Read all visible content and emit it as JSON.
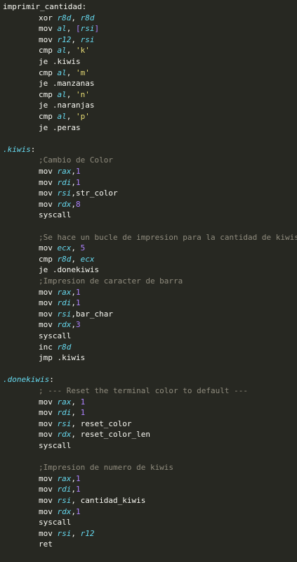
{
  "colors": {
    "background": "#272822",
    "foreground": "#f8f8f2",
    "register": "#66d9ef",
    "number": "#ae81ff",
    "string": "#e6db74",
    "label": "#66d9ef",
    "comment": "#908c7e"
  },
  "code_lines": [
    {
      "indent": 0,
      "tokens": [
        {
          "t": "imprimir_cantidad:",
          "c": "plain"
        }
      ]
    },
    {
      "indent": 1,
      "tokens": [
        {
          "t": "xor ",
          "c": "plain"
        },
        {
          "t": "r8d",
          "c": "reg"
        },
        {
          "t": ", ",
          "c": "plain"
        },
        {
          "t": "r8d",
          "c": "reg"
        }
      ]
    },
    {
      "indent": 1,
      "tokens": [
        {
          "t": "mov ",
          "c": "plain"
        },
        {
          "t": "al",
          "c": "reg"
        },
        {
          "t": ", ",
          "c": "plain"
        },
        {
          "t": "[",
          "c": "num"
        },
        {
          "t": "rsi",
          "c": "reg"
        },
        {
          "t": "]",
          "c": "num"
        }
      ]
    },
    {
      "indent": 1,
      "tokens": [
        {
          "t": "mov ",
          "c": "plain"
        },
        {
          "t": "r12",
          "c": "reg"
        },
        {
          "t": ", ",
          "c": "plain"
        },
        {
          "t": "rsi",
          "c": "reg"
        }
      ]
    },
    {
      "indent": 1,
      "tokens": [
        {
          "t": "cmp ",
          "c": "plain"
        },
        {
          "t": "al",
          "c": "reg"
        },
        {
          "t": ", ",
          "c": "plain"
        },
        {
          "t": "'k'",
          "c": "str"
        }
      ]
    },
    {
      "indent": 1,
      "tokens": [
        {
          "t": "je .kiwis",
          "c": "plain"
        }
      ]
    },
    {
      "indent": 1,
      "tokens": [
        {
          "t": "cmp ",
          "c": "plain"
        },
        {
          "t": "al",
          "c": "reg"
        },
        {
          "t": ", ",
          "c": "plain"
        },
        {
          "t": "'m'",
          "c": "str"
        }
      ]
    },
    {
      "indent": 1,
      "tokens": [
        {
          "t": "je .manzanas",
          "c": "plain"
        }
      ]
    },
    {
      "indent": 1,
      "tokens": [
        {
          "t": "cmp ",
          "c": "plain"
        },
        {
          "t": "al",
          "c": "reg"
        },
        {
          "t": ", ",
          "c": "plain"
        },
        {
          "t": "'n'",
          "c": "str"
        }
      ]
    },
    {
      "indent": 1,
      "tokens": [
        {
          "t": "je .naranjas",
          "c": "plain"
        }
      ]
    },
    {
      "indent": 1,
      "tokens": [
        {
          "t": "cmp ",
          "c": "plain"
        },
        {
          "t": "al",
          "c": "reg"
        },
        {
          "t": ", ",
          "c": "plain"
        },
        {
          "t": "'p'",
          "c": "str"
        }
      ]
    },
    {
      "indent": 1,
      "tokens": [
        {
          "t": "je .peras",
          "c": "plain"
        }
      ]
    },
    {
      "indent": 0,
      "tokens": []
    },
    {
      "indent": 0,
      "tokens": [
        {
          "t": ".kiwis",
          "c": "lbl"
        },
        {
          "t": ":",
          "c": "plain"
        }
      ]
    },
    {
      "indent": 1,
      "tokens": [
        {
          "t": ";Cambio de Color",
          "c": "cmt"
        }
      ]
    },
    {
      "indent": 1,
      "tokens": [
        {
          "t": "mov ",
          "c": "plain"
        },
        {
          "t": "rax",
          "c": "reg"
        },
        {
          "t": ",",
          "c": "plain"
        },
        {
          "t": "1",
          "c": "num"
        }
      ]
    },
    {
      "indent": 1,
      "tokens": [
        {
          "t": "mov ",
          "c": "plain"
        },
        {
          "t": "rdi",
          "c": "reg"
        },
        {
          "t": ",",
          "c": "plain"
        },
        {
          "t": "1",
          "c": "num"
        }
      ]
    },
    {
      "indent": 1,
      "tokens": [
        {
          "t": "mov ",
          "c": "plain"
        },
        {
          "t": "rsi",
          "c": "reg"
        },
        {
          "t": ",str_color",
          "c": "plain"
        }
      ]
    },
    {
      "indent": 1,
      "tokens": [
        {
          "t": "mov ",
          "c": "plain"
        },
        {
          "t": "rdx",
          "c": "reg"
        },
        {
          "t": ",",
          "c": "plain"
        },
        {
          "t": "8",
          "c": "num"
        }
      ]
    },
    {
      "indent": 1,
      "tokens": [
        {
          "t": "syscall",
          "c": "plain"
        }
      ]
    },
    {
      "indent": 0,
      "tokens": []
    },
    {
      "indent": 1,
      "tokens": [
        {
          "t": ";Se hace un bucle de impresion para la cantidad de kiwis",
          "c": "cmt"
        }
      ]
    },
    {
      "indent": 1,
      "tokens": [
        {
          "t": "mov ",
          "c": "plain"
        },
        {
          "t": "ecx",
          "c": "reg"
        },
        {
          "t": ", ",
          "c": "plain"
        },
        {
          "t": "5",
          "c": "num"
        }
      ]
    },
    {
      "indent": 1,
      "tokens": [
        {
          "t": "cmp ",
          "c": "plain"
        },
        {
          "t": "r8d",
          "c": "reg"
        },
        {
          "t": ", ",
          "c": "plain"
        },
        {
          "t": "ecx",
          "c": "reg"
        }
      ]
    },
    {
      "indent": 1,
      "tokens": [
        {
          "t": "je .donekiwis",
          "c": "plain"
        }
      ]
    },
    {
      "indent": 1,
      "tokens": [
        {
          "t": ";Impresion de caracter de barra",
          "c": "cmt"
        }
      ]
    },
    {
      "indent": 1,
      "tokens": [
        {
          "t": "mov ",
          "c": "plain"
        },
        {
          "t": "rax",
          "c": "reg"
        },
        {
          "t": ",",
          "c": "plain"
        },
        {
          "t": "1",
          "c": "num"
        }
      ]
    },
    {
      "indent": 1,
      "tokens": [
        {
          "t": "mov ",
          "c": "plain"
        },
        {
          "t": "rdi",
          "c": "reg"
        },
        {
          "t": ",",
          "c": "plain"
        },
        {
          "t": "1",
          "c": "num"
        }
      ]
    },
    {
      "indent": 1,
      "tokens": [
        {
          "t": "mov ",
          "c": "plain"
        },
        {
          "t": "rsi",
          "c": "reg"
        },
        {
          "t": ",bar_char",
          "c": "plain"
        }
      ]
    },
    {
      "indent": 1,
      "tokens": [
        {
          "t": "mov ",
          "c": "plain"
        },
        {
          "t": "rdx",
          "c": "reg"
        },
        {
          "t": ",",
          "c": "plain"
        },
        {
          "t": "3",
          "c": "num"
        }
      ]
    },
    {
      "indent": 1,
      "tokens": [
        {
          "t": "syscall",
          "c": "plain"
        }
      ]
    },
    {
      "indent": 1,
      "tokens": [
        {
          "t": "inc ",
          "c": "plain"
        },
        {
          "t": "r8d",
          "c": "reg"
        }
      ]
    },
    {
      "indent": 1,
      "tokens": [
        {
          "t": "jmp .kiwis",
          "c": "plain"
        }
      ]
    },
    {
      "indent": 0,
      "tokens": []
    },
    {
      "indent": 0,
      "tokens": [
        {
          "t": ".donekiwis",
          "c": "lbl"
        },
        {
          "t": ":",
          "c": "plain"
        }
      ]
    },
    {
      "indent": 1,
      "tokens": [
        {
          "t": "; --- Reset the terminal color to default ---",
          "c": "cmt"
        }
      ]
    },
    {
      "indent": 1,
      "tokens": [
        {
          "t": "mov ",
          "c": "plain"
        },
        {
          "t": "rax",
          "c": "reg"
        },
        {
          "t": ", ",
          "c": "plain"
        },
        {
          "t": "1",
          "c": "num"
        }
      ]
    },
    {
      "indent": 1,
      "tokens": [
        {
          "t": "mov ",
          "c": "plain"
        },
        {
          "t": "rdi",
          "c": "reg"
        },
        {
          "t": ", ",
          "c": "plain"
        },
        {
          "t": "1",
          "c": "num"
        }
      ]
    },
    {
      "indent": 1,
      "tokens": [
        {
          "t": "mov ",
          "c": "plain"
        },
        {
          "t": "rsi",
          "c": "reg"
        },
        {
          "t": ", reset_color",
          "c": "plain"
        }
      ]
    },
    {
      "indent": 1,
      "tokens": [
        {
          "t": "mov ",
          "c": "plain"
        },
        {
          "t": "rdx",
          "c": "reg"
        },
        {
          "t": ", reset_color_len",
          "c": "plain"
        }
      ]
    },
    {
      "indent": 1,
      "tokens": [
        {
          "t": "syscall",
          "c": "plain"
        }
      ]
    },
    {
      "indent": 0,
      "tokens": []
    },
    {
      "indent": 1,
      "tokens": [
        {
          "t": ";Impresion de numero de kiwis",
          "c": "cmt"
        }
      ]
    },
    {
      "indent": 1,
      "tokens": [
        {
          "t": "mov ",
          "c": "plain"
        },
        {
          "t": "rax",
          "c": "reg"
        },
        {
          "t": ",",
          "c": "plain"
        },
        {
          "t": "1",
          "c": "num"
        }
      ]
    },
    {
      "indent": 1,
      "tokens": [
        {
          "t": "mov ",
          "c": "plain"
        },
        {
          "t": "rdi",
          "c": "reg"
        },
        {
          "t": ",",
          "c": "plain"
        },
        {
          "t": "1",
          "c": "num"
        }
      ]
    },
    {
      "indent": 1,
      "tokens": [
        {
          "t": "mov ",
          "c": "plain"
        },
        {
          "t": "rsi",
          "c": "reg"
        },
        {
          "t": ", cantidad_kiwis",
          "c": "plain"
        }
      ]
    },
    {
      "indent": 1,
      "tokens": [
        {
          "t": "mov ",
          "c": "plain"
        },
        {
          "t": "rdx",
          "c": "reg"
        },
        {
          "t": ",",
          "c": "plain"
        },
        {
          "t": "1",
          "c": "num"
        }
      ]
    },
    {
      "indent": 1,
      "tokens": [
        {
          "t": "syscall",
          "c": "plain"
        }
      ]
    },
    {
      "indent": 1,
      "tokens": [
        {
          "t": "mov ",
          "c": "plain"
        },
        {
          "t": "rsi",
          "c": "reg"
        },
        {
          "t": ", ",
          "c": "plain"
        },
        {
          "t": "r12",
          "c": "reg"
        }
      ]
    },
    {
      "indent": 1,
      "tokens": [
        {
          "t": "ret",
          "c": "plain"
        }
      ]
    }
  ]
}
